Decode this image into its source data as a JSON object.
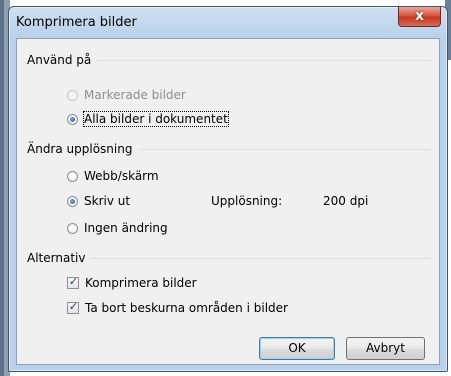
{
  "window": {
    "title": "Komprimera bilder",
    "close_glyph": "x"
  },
  "apply_to": {
    "heading": "Använd på",
    "options": [
      {
        "label": "Markerade bilder",
        "selected": false,
        "enabled": false
      },
      {
        "label": "Alla bilder i dokumentet",
        "selected": true,
        "enabled": true
      }
    ]
  },
  "resolution": {
    "heading": "Ändra upplösning",
    "options": [
      {
        "label": "Webb/skärm",
        "selected": false
      },
      {
        "label": "Skriv ut",
        "selected": true
      },
      {
        "label": "Ingen ändring",
        "selected": false
      }
    ],
    "info_label": "Upplösning:",
    "info_value": "200 dpi"
  },
  "alternatives": {
    "heading": "Alternativ",
    "options": [
      {
        "label": "Komprimera bilder",
        "checked": true
      },
      {
        "label": "Ta bort beskurna områden i bilder",
        "checked": true
      }
    ]
  },
  "buttons": {
    "ok": "OK",
    "cancel": "Avbryt"
  },
  "icons": {
    "close": "close-icon",
    "checkmark": "checkmark-icon"
  }
}
